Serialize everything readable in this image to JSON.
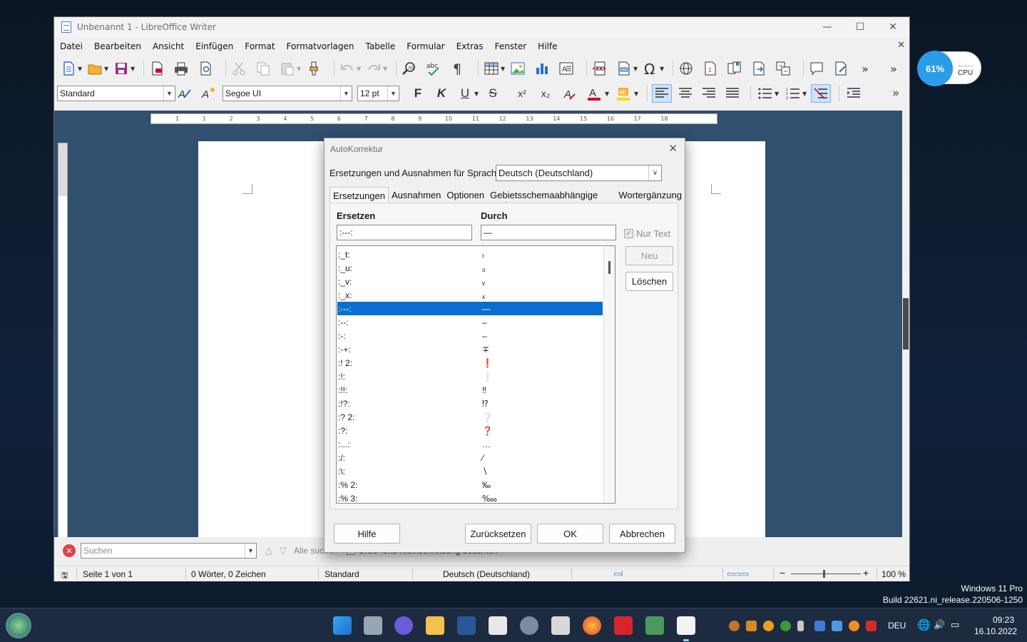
{
  "window": {
    "title": "Unbenannt 1 - LibreOffice Writer",
    "menu": [
      "Datei",
      "Bearbeiten",
      "Ansicht",
      "Einfügen",
      "Format",
      "Formatvorlagen",
      "Tabelle",
      "Formular",
      "Extras",
      "Fenster",
      "Hilfe"
    ]
  },
  "formatting": {
    "paragraph_style": "Standard",
    "font_name": "Segoe UI",
    "font_size": "12 pt",
    "bold": "F",
    "italic": "K",
    "underline": "U",
    "strike": "S",
    "superscript": "x²",
    "subscript": "x₂"
  },
  "ruler": {
    "numbers": [
      "1",
      "1",
      "2",
      "3",
      "4",
      "5",
      "6",
      "7",
      "8",
      "9",
      "10",
      "11",
      "12",
      "13",
      "14",
      "15",
      "16",
      "17",
      "18"
    ]
  },
  "findbar": {
    "placeholder": "Suchen",
    "all_search": "Alle suchen",
    "match_case": "Groß- und Kleinschreibung beachten"
  },
  "statusbar": {
    "page": "Seite 1 von 1",
    "words": "0 Wörter, 0 Zeichen",
    "style": "Standard",
    "language": "Deutsch (Deutschland)",
    "zoom": "100 %"
  },
  "dialog": {
    "title": "AutoKorrektur",
    "language_label": "Ersetzungen und Ausnahmen für Sprache:",
    "language_value": "Deutsch (Deutschland)",
    "tabs": [
      "Ersetzungen",
      "Ausnahmen",
      "Optionen",
      "Gebietsschemaabhängige Optionen",
      "Wortergänzung"
    ],
    "replace_header": "Ersetzen",
    "with_header": "Durch",
    "replace_value": ":---:",
    "with_value": "—",
    "text_only_label": "Nur Text",
    "new_button": "Neu",
    "delete_button": "Löschen",
    "entries": [
      {
        "from": ":_t:",
        "to": "ₜ"
      },
      {
        "from": ":_u:",
        "to": "ᵤ"
      },
      {
        "from": ":_v:",
        "to": "ᵥ"
      },
      {
        "from": ":_x:",
        "to": "ₓ"
      },
      {
        "from": ":---:",
        "to": "—"
      },
      {
        "from": ":--:",
        "to": "–"
      },
      {
        "from": ":-:",
        "to": "–"
      },
      {
        "from": ":-+:",
        "to": "∓"
      },
      {
        "from": ":! 2:",
        "to": "❗"
      },
      {
        "from": ":!:",
        "to": "❕"
      },
      {
        "from": ":!!:",
        "to": "‼"
      },
      {
        "from": ":!?:",
        "to": "⁉"
      },
      {
        "from": ":? 2:",
        "to": "❔"
      },
      {
        "from": ":?:",
        "to": "❓"
      },
      {
        "from": ":...:",
        "to": "…"
      },
      {
        "from": ":/:",
        "to": "⁄"
      },
      {
        "from": ":\\:",
        "to": "∖"
      },
      {
        "from": ":% 2:",
        "to": "‰"
      },
      {
        "from": ":% 3:",
        "to": "‱"
      }
    ],
    "selected_index": 4,
    "help_button": "Hilfe",
    "reset_button": "Zurücksetzen",
    "ok_button": "OK",
    "cancel_button": "Abbrechen"
  },
  "cpu_widget": {
    "percent": "61%",
    "label": "CPU"
  },
  "watermark": {
    "line1": "Windows 11 Pro",
    "line2": "Build 22621.ni_release.220506-1250"
  },
  "taskbar": {
    "language": "DEU",
    "time": "09:23",
    "date": "16.10.2022"
  },
  "colors": {
    "accent": "#0a6ed1",
    "workspace": "#314f6e",
    "cpu": "#2c9ce8"
  }
}
